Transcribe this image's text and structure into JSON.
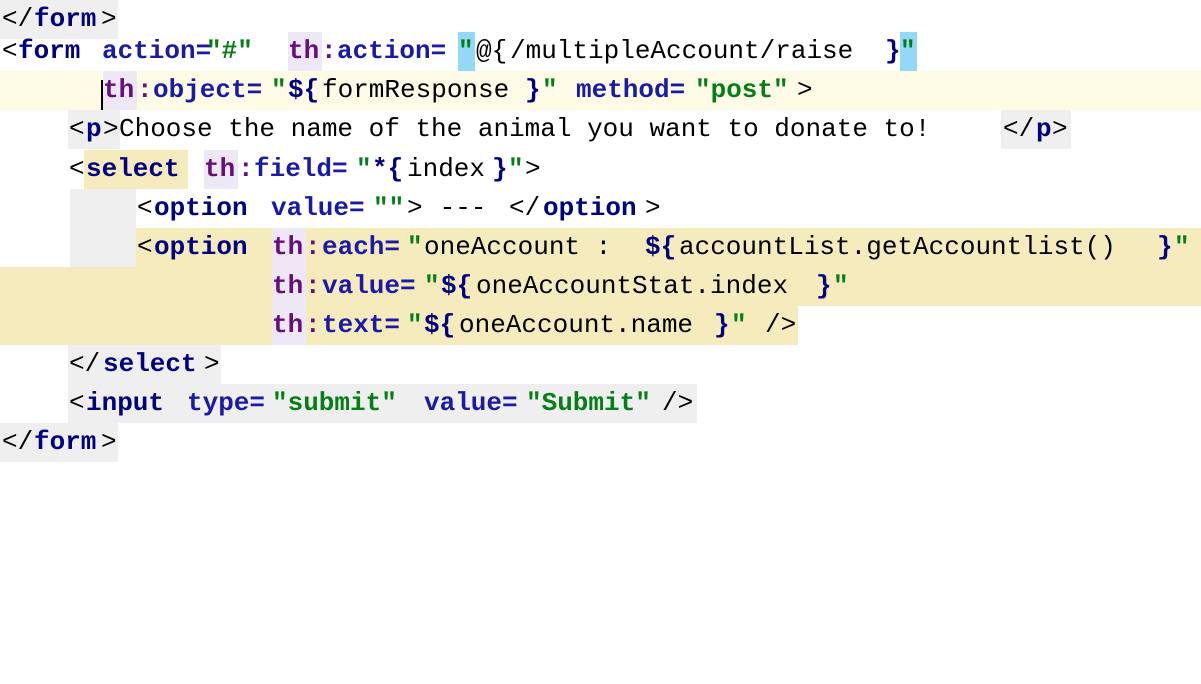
{
  "editor": {
    "language": "Thymeleaf HTML",
    "lines": [
      {
        "text": "</form>"
      },
      {
        "text": "<form action=\"#\" th:action=\"@{/multipleAccount/raise}\""
      },
      {
        "text": "th:object=\"${formResponse}\" method=\"post\">"
      },
      {
        "text": "<p>Choose the name of the animal you want to donate to!</p>"
      },
      {
        "text": "<select th:field=\"*{index}\">"
      },
      {
        "text": "<option value=\"\"> --- </option>"
      },
      {
        "text": "<option th:each=\"oneAccount : ${accountList.getAccountlist()}\""
      },
      {
        "text": "th:value=\"${oneAccountStat.index}\""
      },
      {
        "text": "th:text=\"${oneAccount.name}\" />"
      },
      {
        "text": "</select>"
      },
      {
        "text": "<input type=\"submit\" value=\"Submit\"/>"
      },
      {
        "text": "</form>"
      }
    ],
    "tokens": {
      "lt": "<",
      "gt": ">",
      "lt_slash": "</",
      "slash_gt": "/>",
      "form": "form",
      "p": "p",
      "select": "select",
      "option": "option",
      "input": "input",
      "th": "th",
      "colon": ":",
      "action": "action=",
      "object": "object=",
      "method": "method=",
      "field": "field=",
      "value": "value=",
      "each": "each=",
      "text_attr": "text=",
      "type": "type=",
      "q": "\"",
      "hash_str": "\"#\"",
      "at": "@{",
      "url": "/multipleAccount/raise",
      "close_brace": "}",
      "dollar": "${",
      "star": "*{",
      "formResponse": "formResponse",
      "post_str": "\"post\"",
      "p_text": "Choose the name of the animal you want to donate to!",
      "index": "index",
      "empty_str": "\"\"",
      "dashes": " --- ",
      "oneAccount_colon": "oneAccount : ",
      "getAccountlist": "accountList.getAccountlist()",
      "oneAccountStat": "oneAccountStat.index",
      "oneAccountName": "oneAccount.name",
      "submit_str": "\"submit\"",
      "Submit_str": "\"Submit\"",
      "space": " "
    }
  }
}
